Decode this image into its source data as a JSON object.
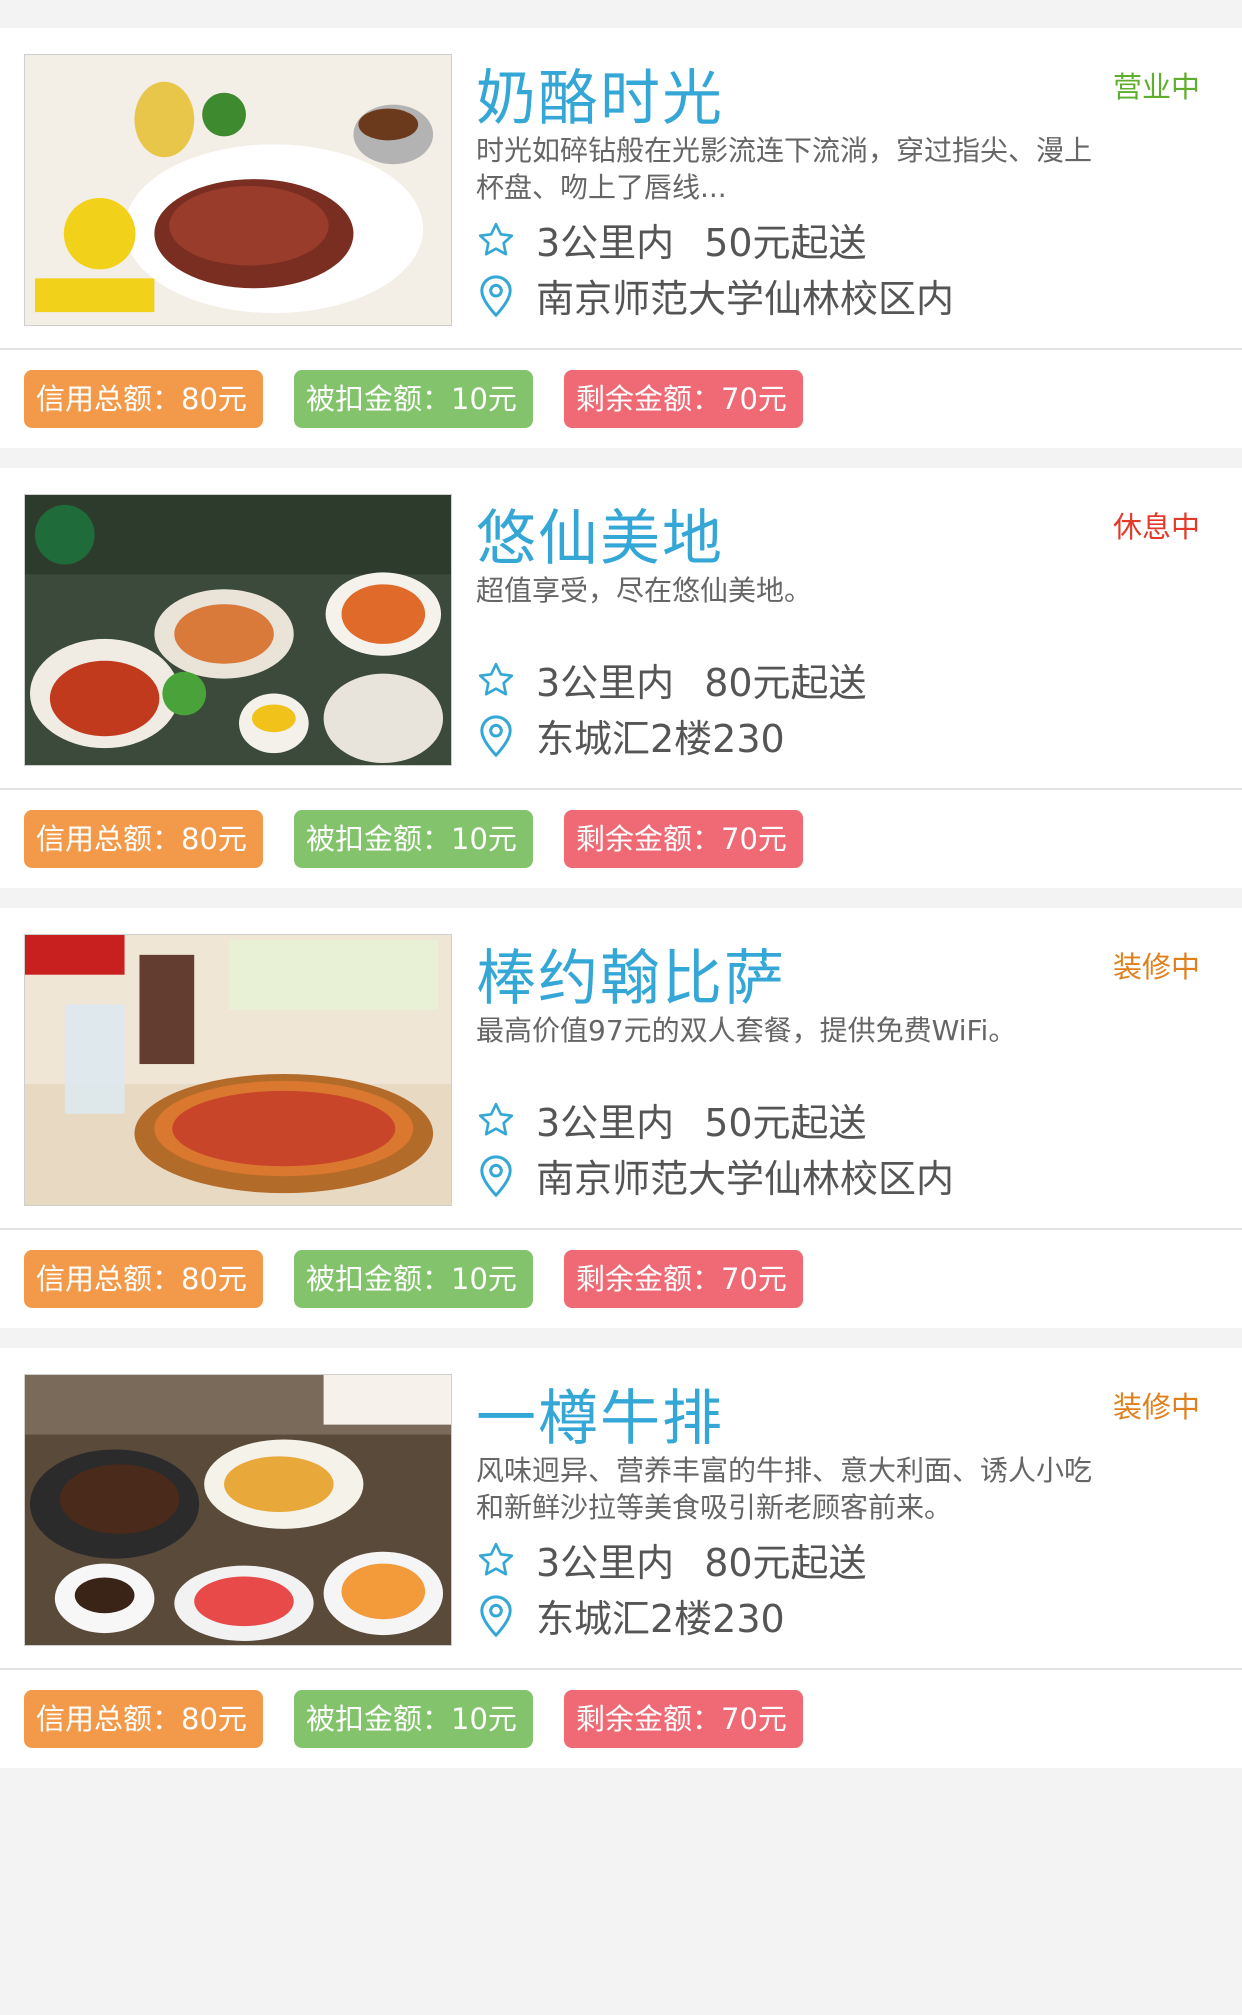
{
  "colors": {
    "brand_blue": "#35a7d6",
    "chip_credit": "#f39a4a",
    "chip_deducted": "#82c36b",
    "chip_remaining": "#ef6a74",
    "status_open": "#5fae2e",
    "status_resting": "#e23a2a",
    "status_renovating": "#e0801d"
  },
  "icons": {
    "range": "star-outline-icon",
    "address": "location-pin-icon"
  },
  "restaurants": [
    {
      "name": "奶酪时光",
      "status": "营业中",
      "status_color": "#5fae2e",
      "desc": "时光如碎钻般在光影流连下流淌，穿过指尖、漫上杯盘、吻上了唇线...",
      "distance": "3公里内",
      "min_order": "50元起送",
      "address": "南京师范大学仙林校区内",
      "credit_total": "信用总额：80元",
      "deducted": "被扣金额：10元",
      "remaining": "剩余金额：70元"
    },
    {
      "name": "悠仙美地",
      "status": "休息中",
      "status_color": "#e23a2a",
      "desc": "超值享受，尽在悠仙美地。",
      "distance": "3公里内",
      "min_order": "80元起送",
      "address": "东城汇2楼230",
      "credit_total": "信用总额：80元",
      "deducted": "被扣金额：10元",
      "remaining": "剩余金额：70元"
    },
    {
      "name": "棒约翰比萨",
      "status": "装修中",
      "status_color": "#e0801d",
      "desc": "最高价值97元的双人套餐，提供免费WiFi。",
      "distance": "3公里内",
      "min_order": "50元起送",
      "address": "南京师范大学仙林校区内",
      "credit_total": "信用总额：80元",
      "deducted": "被扣金额：10元",
      "remaining": "剩余金额：70元"
    },
    {
      "name": "一樽牛排",
      "status": "装修中",
      "status_color": "#e0801d",
      "desc": "风味迥异、营养丰富的牛排、意大利面、诱人小吃和新鲜沙拉等美食吸引新老顾客前来。",
      "distance": "3公里内",
      "min_order": "80元起送",
      "address": "东城汇2楼230",
      "credit_total": "信用总额：80元",
      "deducted": "被扣金额：10元",
      "remaining": "剩余金额：70元"
    }
  ]
}
